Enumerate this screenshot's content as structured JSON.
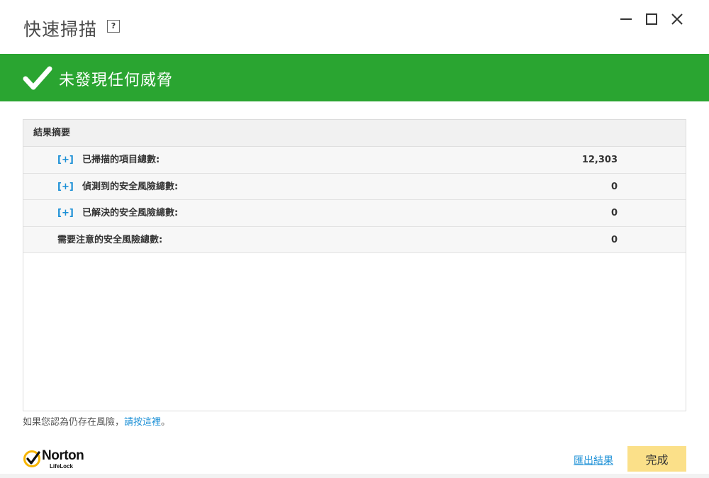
{
  "window": {
    "title": "快速掃描",
    "help_label": "?"
  },
  "banner": {
    "status_text": "未發現任何威脅",
    "color": "#2aa531"
  },
  "summary": {
    "header": "結果摘要",
    "rows": [
      {
        "toggle": "[+]",
        "label": "已掃描的項目總數:",
        "value": "12,303"
      },
      {
        "toggle": "[+]",
        "label": "偵測到的安全風險總數:",
        "value": "0"
      },
      {
        "toggle": "[+]",
        "label": "已解決的安全風險總數:",
        "value": "0"
      },
      {
        "toggle": "",
        "label": "需要注意的安全風險總數:",
        "value": "0"
      }
    ]
  },
  "note": {
    "prefix": "如果您認為仍存在風險，",
    "link": "請按這裡",
    "suffix": "。"
  },
  "footer": {
    "logo_word": "Norton",
    "logo_sub": "LifeLock",
    "export_label": "匯出結果",
    "done_label": "完成",
    "accent_color": "#fbe089",
    "link_color": "#1a8fd6"
  }
}
